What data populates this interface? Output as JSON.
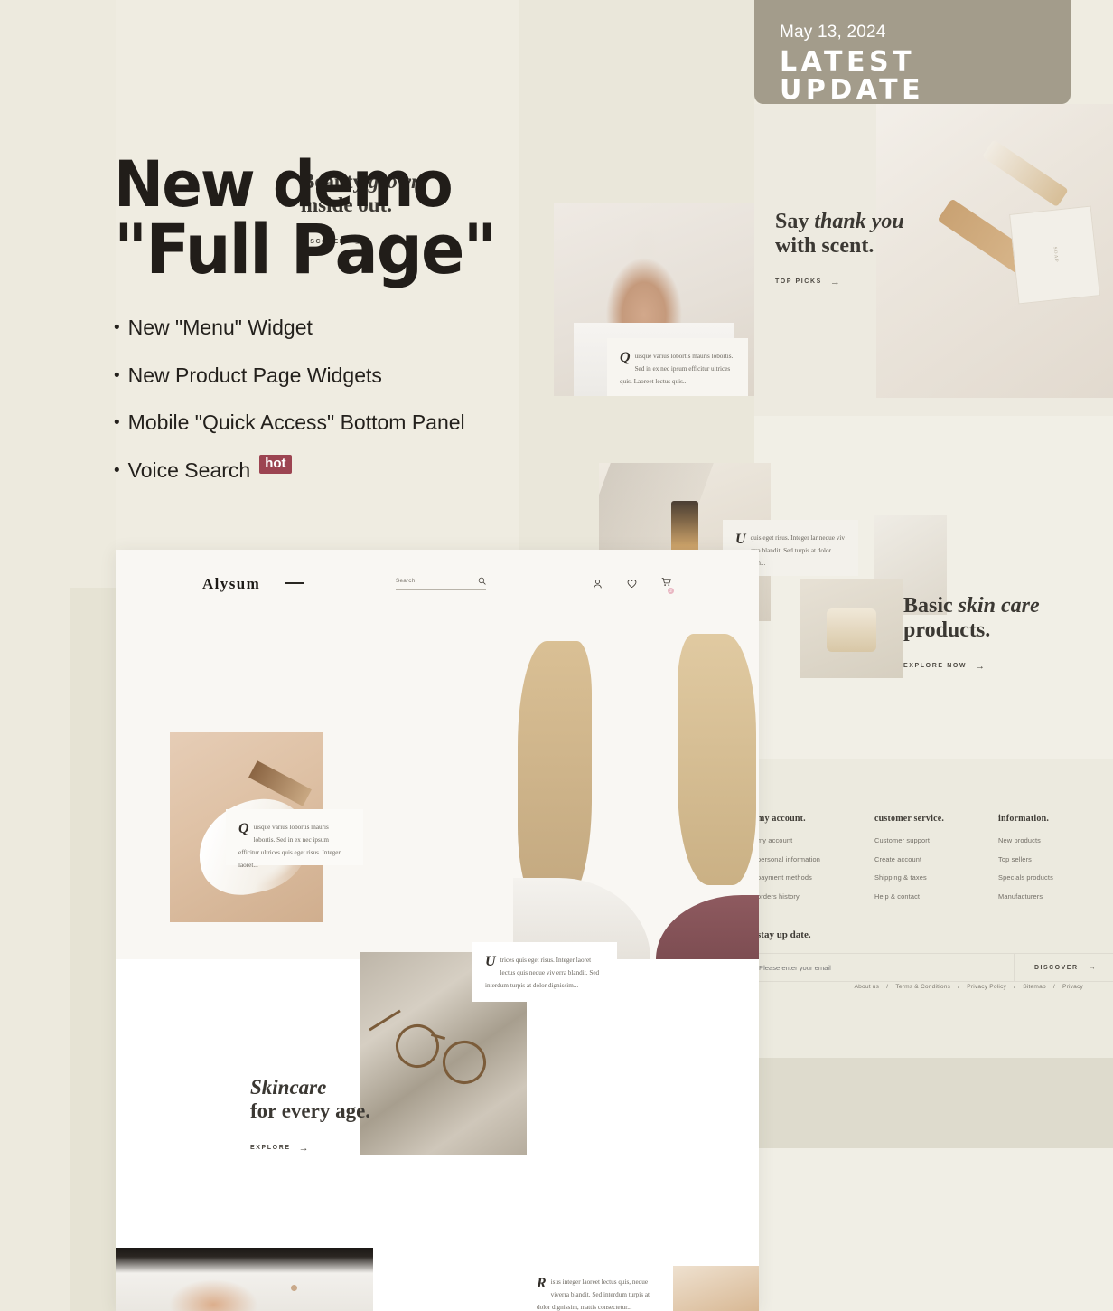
{
  "badge": {
    "date": "May 13, 2024",
    "title": "LATEST UPDATE",
    "bg_color": "#a39c8b"
  },
  "headline": {
    "line1": "New demo",
    "line2": "\"Full Page\""
  },
  "features": [
    {
      "bullet": "•",
      "label": "New \"Menu\" Widget",
      "tag": ""
    },
    {
      "bullet": "•",
      "label": "New Product Page Widgets",
      "tag": ""
    },
    {
      "bullet": "•",
      "label": "Mobile \"Quick Access\" Bottom Panel",
      "tag": ""
    },
    {
      "bullet": "•",
      "label": "Voice Search",
      "tag": "hot"
    }
  ],
  "hot_badge": {
    "label": "hot",
    "color": "#9c4451"
  },
  "mockup": {
    "header": {
      "logo": "Alysum",
      "search_placeholder": "Search",
      "cart_count": "2"
    },
    "hero": {
      "title_plain": "Beauty ",
      "title_italic": "grown",
      "title_line2": "inside out.",
      "cta": "DISCOVER",
      "arrow": "→"
    },
    "quote_hero": {
      "dropcap": "Q",
      "text": "uisque varius lobortis mauris lobortis. Sed in ex nec ipsum efficitur ultrices quis eget risus. Integer laoret..."
    },
    "quote_mid": {
      "dropcap": "U",
      "text": "trices quis eget risus. Integer laoret lectus quis neque viv erra blandit. Sed interdum turpis at dolor dignissim..."
    },
    "skincare": {
      "title_italic": "Skincare",
      "title_line2": "for every age.",
      "cta": "EXPLORE",
      "arrow": "→"
    },
    "quote_bottom": {
      "dropcap": "R",
      "text": "isus integer laoreet lectus quis, neque viverra blandit. Sed interdum turpis at dolor dignissim, mattis consectetur..."
    }
  },
  "background_site": {
    "scent": {
      "title_plain": "Say ",
      "title_italic": "thank you",
      "title_line2": "with scent.",
      "cta": "TOP PICKS",
      "arrow": "→"
    },
    "skincare_products": {
      "title_plain": "Basic ",
      "title_italic": "skin care",
      "title_line2": "products.",
      "cta": "EXPLORE NOW",
      "arrow": "→"
    },
    "quote_top": {
      "dropcap": "Q",
      "text": "uisque varius lobortis mauris lobortis. Sed in ex nec ipsum efficitur ultrices quis. Laoreet lectus quis..."
    },
    "quote_side": {
      "dropcap": "U",
      "text": "quis eget risus. Integer lar neque viv erra blandit. Sed turpis at dolor dignissim..."
    },
    "soap_label": "SOAP",
    "footer": {
      "columns": [
        {
          "title": "my account.",
          "links": [
            "my account",
            "personal information",
            "payment methods",
            "orders history"
          ]
        },
        {
          "title": "customer service.",
          "links": [
            "Customer support",
            "Create account",
            "Shipping & taxes",
            "Help & contact"
          ]
        },
        {
          "title": "information.",
          "links": [
            "New products",
            "Top sellers",
            "Specials products",
            "Manufacturers"
          ]
        }
      ],
      "newsletter": {
        "title": "stay up date.",
        "placeholder": "Please enter your email",
        "button": "DISCOVER",
        "arrow": "→"
      },
      "legal_links": [
        "About us",
        "Terms & Conditions",
        "Privacy Policy",
        "Sitemap",
        "Privacy"
      ],
      "legal_sep": "/"
    }
  }
}
